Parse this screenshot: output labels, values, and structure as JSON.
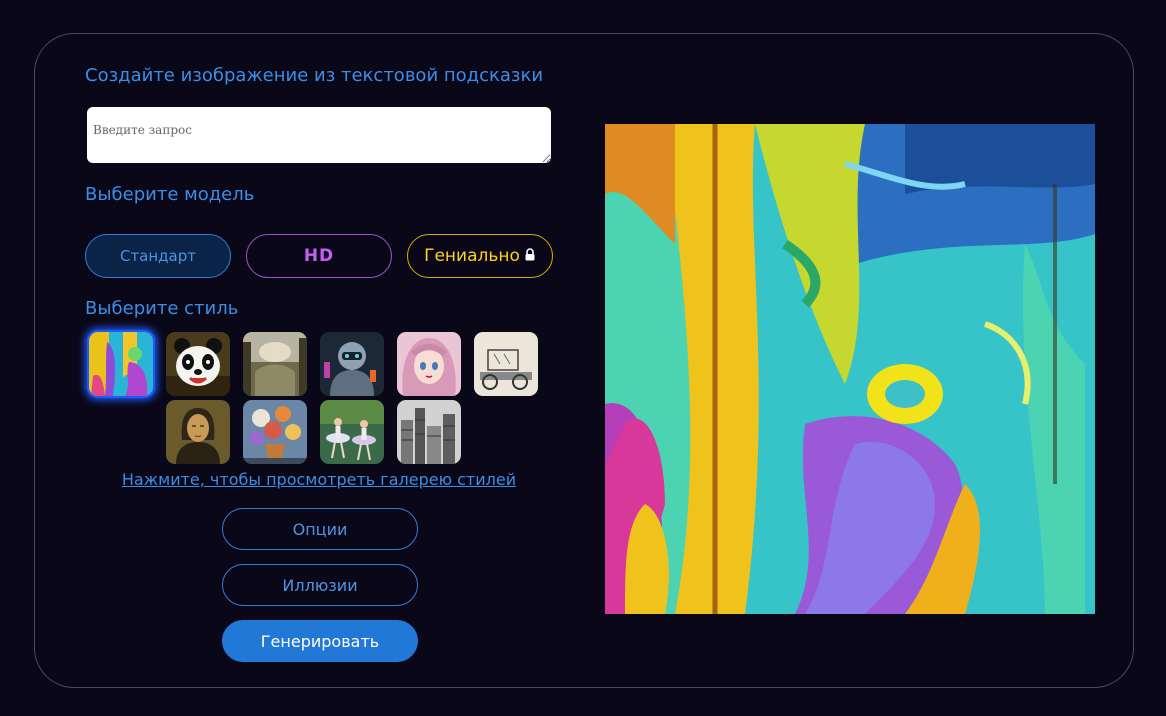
{
  "headings": {
    "create": "Создайте изображение из текстовой подсказки",
    "model": "Выберите модель",
    "style": "Выберите стиль"
  },
  "prompt": {
    "placeholder": "Введите запрос",
    "value": ""
  },
  "models": {
    "standard": "Стандарт",
    "hd": "HD",
    "genius": "Гениально",
    "genius_icon": "lock-icon"
  },
  "styles": {
    "selected_index": 0,
    "items": [
      {
        "name": "abstract-painting-style"
      },
      {
        "name": "panda-cartoon-style"
      },
      {
        "name": "landscape-painting-style"
      },
      {
        "name": "robot-scifi-style"
      },
      {
        "name": "anime-portrait-style"
      },
      {
        "name": "vintage-car-sketch-style"
      },
      {
        "name": "classic-portrait-style"
      },
      {
        "name": "flower-still-life-style"
      },
      {
        "name": "ballet-dancers-style"
      },
      {
        "name": "city-engraving-style"
      }
    ]
  },
  "gallery_link": "Нажмите, чтобы просмотреть галерею стилей",
  "buttons": {
    "options": "Опции",
    "illusions": "Иллюзии",
    "generate": "Генерировать"
  },
  "colors": {
    "background": "#0a0719",
    "accent": "#3a8ee6",
    "hd": "#c75ff0",
    "genius": "#ffd21f",
    "generate": "#2178d6"
  }
}
